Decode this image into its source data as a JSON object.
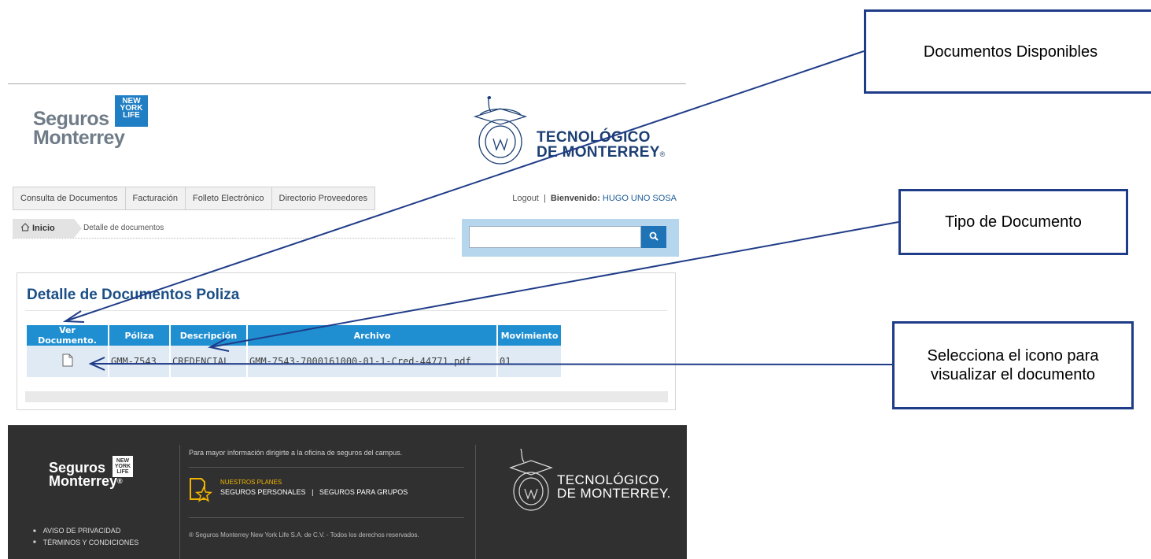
{
  "header": {
    "brand_seguros_line1": "Seguros",
    "brand_seguros_line2": "Monterrey",
    "brand_nyl": [
      "NEW",
      "YORK",
      "LIFE"
    ],
    "brand_tec_line1": "TECNOLÓGICO",
    "brand_tec_line2": "DE MONTERREY"
  },
  "nav": {
    "items": [
      "Consulta de Documentos",
      "Facturación",
      "Folleto Electrónico",
      "Directorio Proveedores"
    ]
  },
  "userbar": {
    "logout": "Logout",
    "separator": "|",
    "welcome_label": "Bienvenido:",
    "username": "HUGO UNO SOSA"
  },
  "breadcrumb": {
    "home": "Inicio",
    "current": "Detalle de documentos"
  },
  "search": {
    "value": ""
  },
  "panel": {
    "title": "Detalle de Documentos Poliza",
    "table": {
      "headers": [
        "Ver Documento.",
        "Póliza",
        "Descripción",
        "Archivo",
        "Movimiento"
      ],
      "rows": [
        {
          "icon": "document-icon",
          "poliza": "GMM-7543",
          "descripcion": "CREDENCIAL",
          "archivo": "GMM-7543-7000161000-01-1-Cred-44771.pdf",
          "movimiento": "01"
        }
      ]
    }
  },
  "footer": {
    "info": "Para mayor información dirigirte a la oficina de seguros del campus.",
    "planes_label": "NUESTROS PLANES",
    "planes_personales": "SEGUROS PERSONALES",
    "planes_separator": "|",
    "planes_grupos": "SEGUROS PARA GRUPOS",
    "copyright": "® Seguros Monterrey New York Life S.A. de C.V. - Todos los derechos reservados.",
    "links": [
      "AVISO DE PRIVACIDAD",
      "TÉRMINOS Y CONDICIONES"
    ],
    "brand_seguros_line1": "Seguros",
    "brand_seguros_line2": "Monterrey",
    "brand_tec_line1": "TECNOLÓGICO",
    "brand_tec_line2": "DE MONTERREY."
  },
  "callouts": {
    "documentos_disponibles": "Documentos Disponibles",
    "tipo_documento": "Tipo de Documento",
    "selecciona_icono": "Selecciona el icono para visualizar el documento"
  },
  "colors": {
    "accent_blue": "#1f8fd2",
    "title_blue": "#1c4f86",
    "callout_border": "#1f3c88",
    "footer_bg": "#303030"
  }
}
